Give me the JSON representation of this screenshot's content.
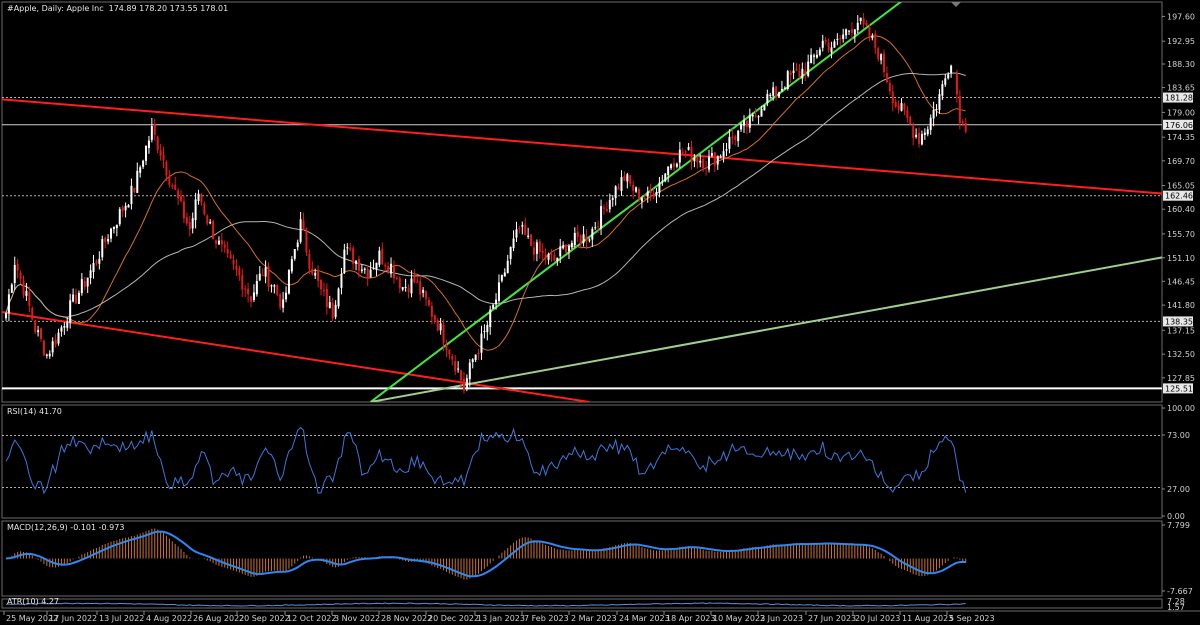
{
  "chart_data": {
    "type": "candlestick",
    "header": {
      "symbol": "#Apple, Daily:  Apple Inc",
      "ohlc": "174.89 178.20 173.55 178.01"
    },
    "price_axis": {
      "ylim": [
        122.9,
        199.6
      ],
      "ticks": [
        "197.60",
        "192.95",
        "188.30",
        "183.65",
        "179.00",
        "174.35",
        "169.70",
        "165.05",
        "160.40",
        "155.70",
        "151.10",
        "146.45",
        "141.80",
        "137.15",
        "132.50",
        "127.85"
      ],
      "horizontal_levels": [
        {
          "value": 181.28,
          "label": "181.28",
          "style": "dotted"
        },
        {
          "value": 176.06,
          "label": "176.06",
          "style": "solid"
        },
        {
          "value": 162.46,
          "label": "162.46",
          "style": "dotted"
        },
        {
          "value": 138.35,
          "label": "138.35",
          "style": "dotted"
        },
        {
          "value": 125.51,
          "label": "125.51",
          "style": "solid-white"
        }
      ]
    },
    "x_axis": {
      "labels": [
        "25 May 2022",
        "17 Jun 2022",
        "13 Jul 2022",
        "4 Aug 2022",
        "26 Aug 2022",
        "20 Sep 2022",
        "12 Oct 2022",
        "3 Nov 2022",
        "28 Nov 2022",
        "20 Dec 2022",
        "13 Jan 2023",
        "7 Feb 2023",
        "2 Mar 2023",
        "24 Mar 2023",
        "18 Apr 2023",
        "10 May 2023",
        "2 Jun 2023",
        "27 Jun 2023",
        "20 Jul 2023",
        "11 Aug 2023",
        "5 Sep 2023"
      ]
    },
    "price_path": [
      [
        0,
        140
      ],
      [
        3,
        150
      ],
      [
        7,
        143
      ],
      [
        10,
        137
      ],
      [
        14,
        132
      ],
      [
        18,
        136
      ],
      [
        22,
        141
      ],
      [
        26,
        145
      ],
      [
        30,
        149
      ],
      [
        35,
        155
      ],
      [
        40,
        160
      ],
      [
        44,
        164
      ],
      [
        47,
        170
      ],
      [
        50,
        175
      ],
      [
        53,
        171
      ],
      [
        56,
        166
      ],
      [
        60,
        160
      ],
      [
        63,
        156
      ],
      [
        66,
        163
      ],
      [
        69,
        158
      ],
      [
        72,
        154
      ],
      [
        76,
        150
      ],
      [
        80,
        147
      ],
      [
        84,
        143
      ],
      [
        88,
        148
      ],
      [
        92,
        145
      ],
      [
        95,
        141
      ],
      [
        98,
        150
      ],
      [
        101,
        157
      ],
      [
        104,
        150
      ],
      [
        108,
        144
      ],
      [
        112,
        140
      ],
      [
        116,
        152
      ],
      [
        120,
        150
      ],
      [
        124,
        148
      ],
      [
        128,
        151
      ],
      [
        132,
        149
      ],
      [
        136,
        145
      ],
      [
        140,
        146
      ],
      [
        144,
        142
      ],
      [
        148,
        138
      ],
      [
        152,
        133
      ],
      [
        155,
        129
      ],
      [
        157,
        125.5
      ],
      [
        160,
        131
      ],
      [
        164,
        136
      ],
      [
        167,
        141
      ],
      [
        170,
        146
      ],
      [
        173,
        152
      ],
      [
        176,
        156
      ],
      [
        180,
        153
      ],
      [
        184,
        151
      ],
      [
        188,
        150
      ],
      [
        192,
        153
      ],
      [
        196,
        154
      ],
      [
        200,
        155
      ],
      [
        204,
        159
      ],
      [
        208,
        163
      ],
      [
        212,
        166
      ],
      [
        216,
        163
      ],
      [
        220,
        162
      ],
      [
        224,
        165
      ],
      [
        228,
        169
      ],
      [
        232,
        171
      ],
      [
        236,
        170
      ],
      [
        240,
        169
      ],
      [
        244,
        170
      ],
      [
        248,
        173
      ],
      [
        252,
        175
      ],
      [
        256,
        177
      ],
      [
        260,
        181
      ],
      [
        264,
        182
      ],
      [
        268,
        185
      ],
      [
        272,
        186
      ],
      [
        276,
        188
      ],
      [
        280,
        192
      ],
      [
        284,
        191
      ],
      [
        288,
        194
      ],
      [
        292,
        196
      ],
      [
        296,
        193
      ],
      [
        299,
        190
      ],
      [
        302,
        185
      ],
      [
        305,
        180
      ],
      [
        308,
        178
      ],
      [
        311,
        175
      ],
      [
        313,
        173.5
      ],
      [
        316,
        176
      ],
      [
        319,
        180
      ],
      [
        322,
        185
      ],
      [
        324,
        189
      ],
      [
        326,
        182
      ],
      [
        327,
        178
      ],
      [
        328,
        176
      ]
    ],
    "trendlines": [
      {
        "name": "red-channel-top",
        "color": "#ff1e1e",
        "points": [
          [
            -3,
            181
          ],
          [
            400,
            162.7
          ]
        ]
      },
      {
        "name": "red-channel-bottom",
        "color": "#ff1e1e",
        "points": [
          [
            -3,
            140.3
          ],
          [
            200,
            122.9
          ]
        ]
      },
      {
        "name": "green-support-steep",
        "color": "#3ee83e",
        "points": [
          [
            125,
            122.9
          ],
          [
            310,
            201
          ]
        ]
      },
      {
        "name": "light-green-long",
        "color": "#9ecf8e",
        "points": [
          [
            125,
            122.9
          ],
          [
            400,
            151
          ]
        ]
      }
    ],
    "moving_averages": [
      {
        "name": "MA-short",
        "color": "#d2701f"
      },
      {
        "name": "MA-long",
        "color": "#b4b4b4"
      }
    ],
    "rsi": {
      "label": "RSI(14) 41.70",
      "period": 14,
      "value": 41.7,
      "ylim": [
        0,
        100
      ],
      "ticks": [
        "100.00",
        "73.00",
        "27.00",
        "0.00"
      ],
      "levels": [
        73,
        27
      ]
    },
    "macd": {
      "label": "MACD(12,26,9) -0.101 -0.973",
      "ticks": [
        "7.799",
        "-7.667"
      ],
      "ylim": [
        -9,
        9
      ]
    },
    "atr": {
      "label": "ATR(10) 4.27",
      "ticks": [
        "7.28",
        "1.57"
      ],
      "ylim": [
        0,
        9
      ]
    },
    "colors": {
      "background": "#000000",
      "bull": "#ffffff",
      "bear": "#e31a1a",
      "rsi_line": "#3c78d8",
      "macd_hist": "#c8742a",
      "macd_signal": "#2f86f5",
      "atr_line": "#5c8fd6"
    }
  }
}
